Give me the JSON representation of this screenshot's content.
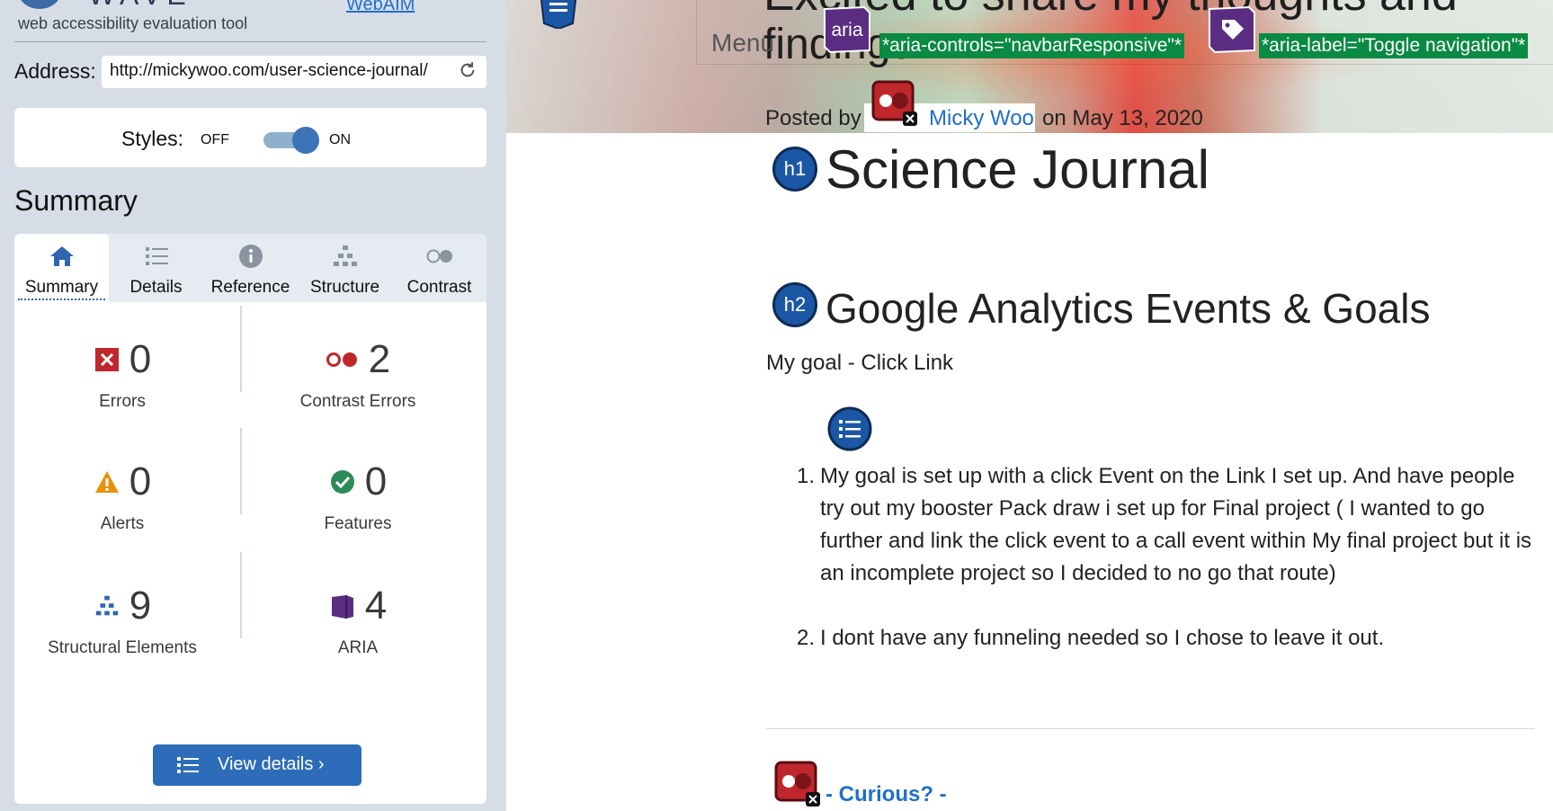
{
  "sidebar": {
    "brand": {
      "name_partial": "WAVE",
      "tagline": "web accessibility evaluation tool",
      "link": "WebAIM"
    },
    "address": {
      "label": "Address:",
      "value": "http://mickywoo.com/user-science-journal/"
    },
    "styles": {
      "label": "Styles:",
      "off": "OFF",
      "on": "ON",
      "enabled": true
    },
    "summary_heading": "Summary",
    "tabs": [
      {
        "label": "Summary",
        "icon": "home-icon",
        "active": true
      },
      {
        "label": "Details",
        "icon": "list-icon",
        "active": false
      },
      {
        "label": "Reference",
        "icon": "info-icon",
        "active": false
      },
      {
        "label": "Structure",
        "icon": "hierarchy-icon",
        "active": false
      },
      {
        "label": "Contrast",
        "icon": "contrast-icon",
        "active": false
      }
    ],
    "stats": {
      "errors": {
        "count": "0",
        "label": "Errors",
        "icon": "error-icon",
        "color": "#c0272d"
      },
      "contrast": {
        "count": "2",
        "label": "Contrast Errors",
        "icon": "contrast-error-icon",
        "color": "#c0272d"
      },
      "alerts": {
        "count": "0",
        "label": "Alerts",
        "icon": "alert-icon",
        "color": "#e8910c"
      },
      "features": {
        "count": "0",
        "label": "Features",
        "icon": "feature-icon",
        "color": "#2e8b57"
      },
      "structural": {
        "count": "9",
        "label": "Structural Elements",
        "icon": "structure-icon",
        "color": "#2f66b3"
      },
      "aria": {
        "count": "4",
        "label": "ARIA",
        "icon": "aria-icon",
        "color": "#5a2d82"
      }
    },
    "view_details": "View details ›"
  },
  "page": {
    "hero": {
      "title_line1": "Excited to share my thoughts and",
      "title_line2": "findings",
      "menu": "Menu",
      "aria_badge": "aria",
      "aria_controls": "*aria-controls=\"navbarResponsive\"*",
      "aria_label": "*aria-label=\"Toggle navigation\"*",
      "posted_by": "Posted by",
      "author": "Micky Woo",
      "date": "on May 13, 2020"
    },
    "h1_badge": "h1",
    "h1": "Science Journal",
    "h2_badge": "h2",
    "h2": "Google Analytics Events & Goals",
    "goal": "My goal - Click Link",
    "list": [
      {
        "num": "1.",
        "text": "My goal is set up with a click Event on the Link I set up. And have people try out my booster Pack draw i set up for Final project ( I wanted to go further and link the click event to a call event within My final project but it is an incomplete project so I decided to no go that route)"
      },
      {
        "num": "2.",
        "text": "I dont have any funneling needed so I chose to leave it out."
      }
    ],
    "curious": "- Curious? -"
  },
  "colors": {
    "sidebar_bg": "#d6dde6",
    "accent_blue": "#2d6cb8",
    "aria_green": "#0a8a43",
    "link_blue": "#1f6fcc"
  }
}
